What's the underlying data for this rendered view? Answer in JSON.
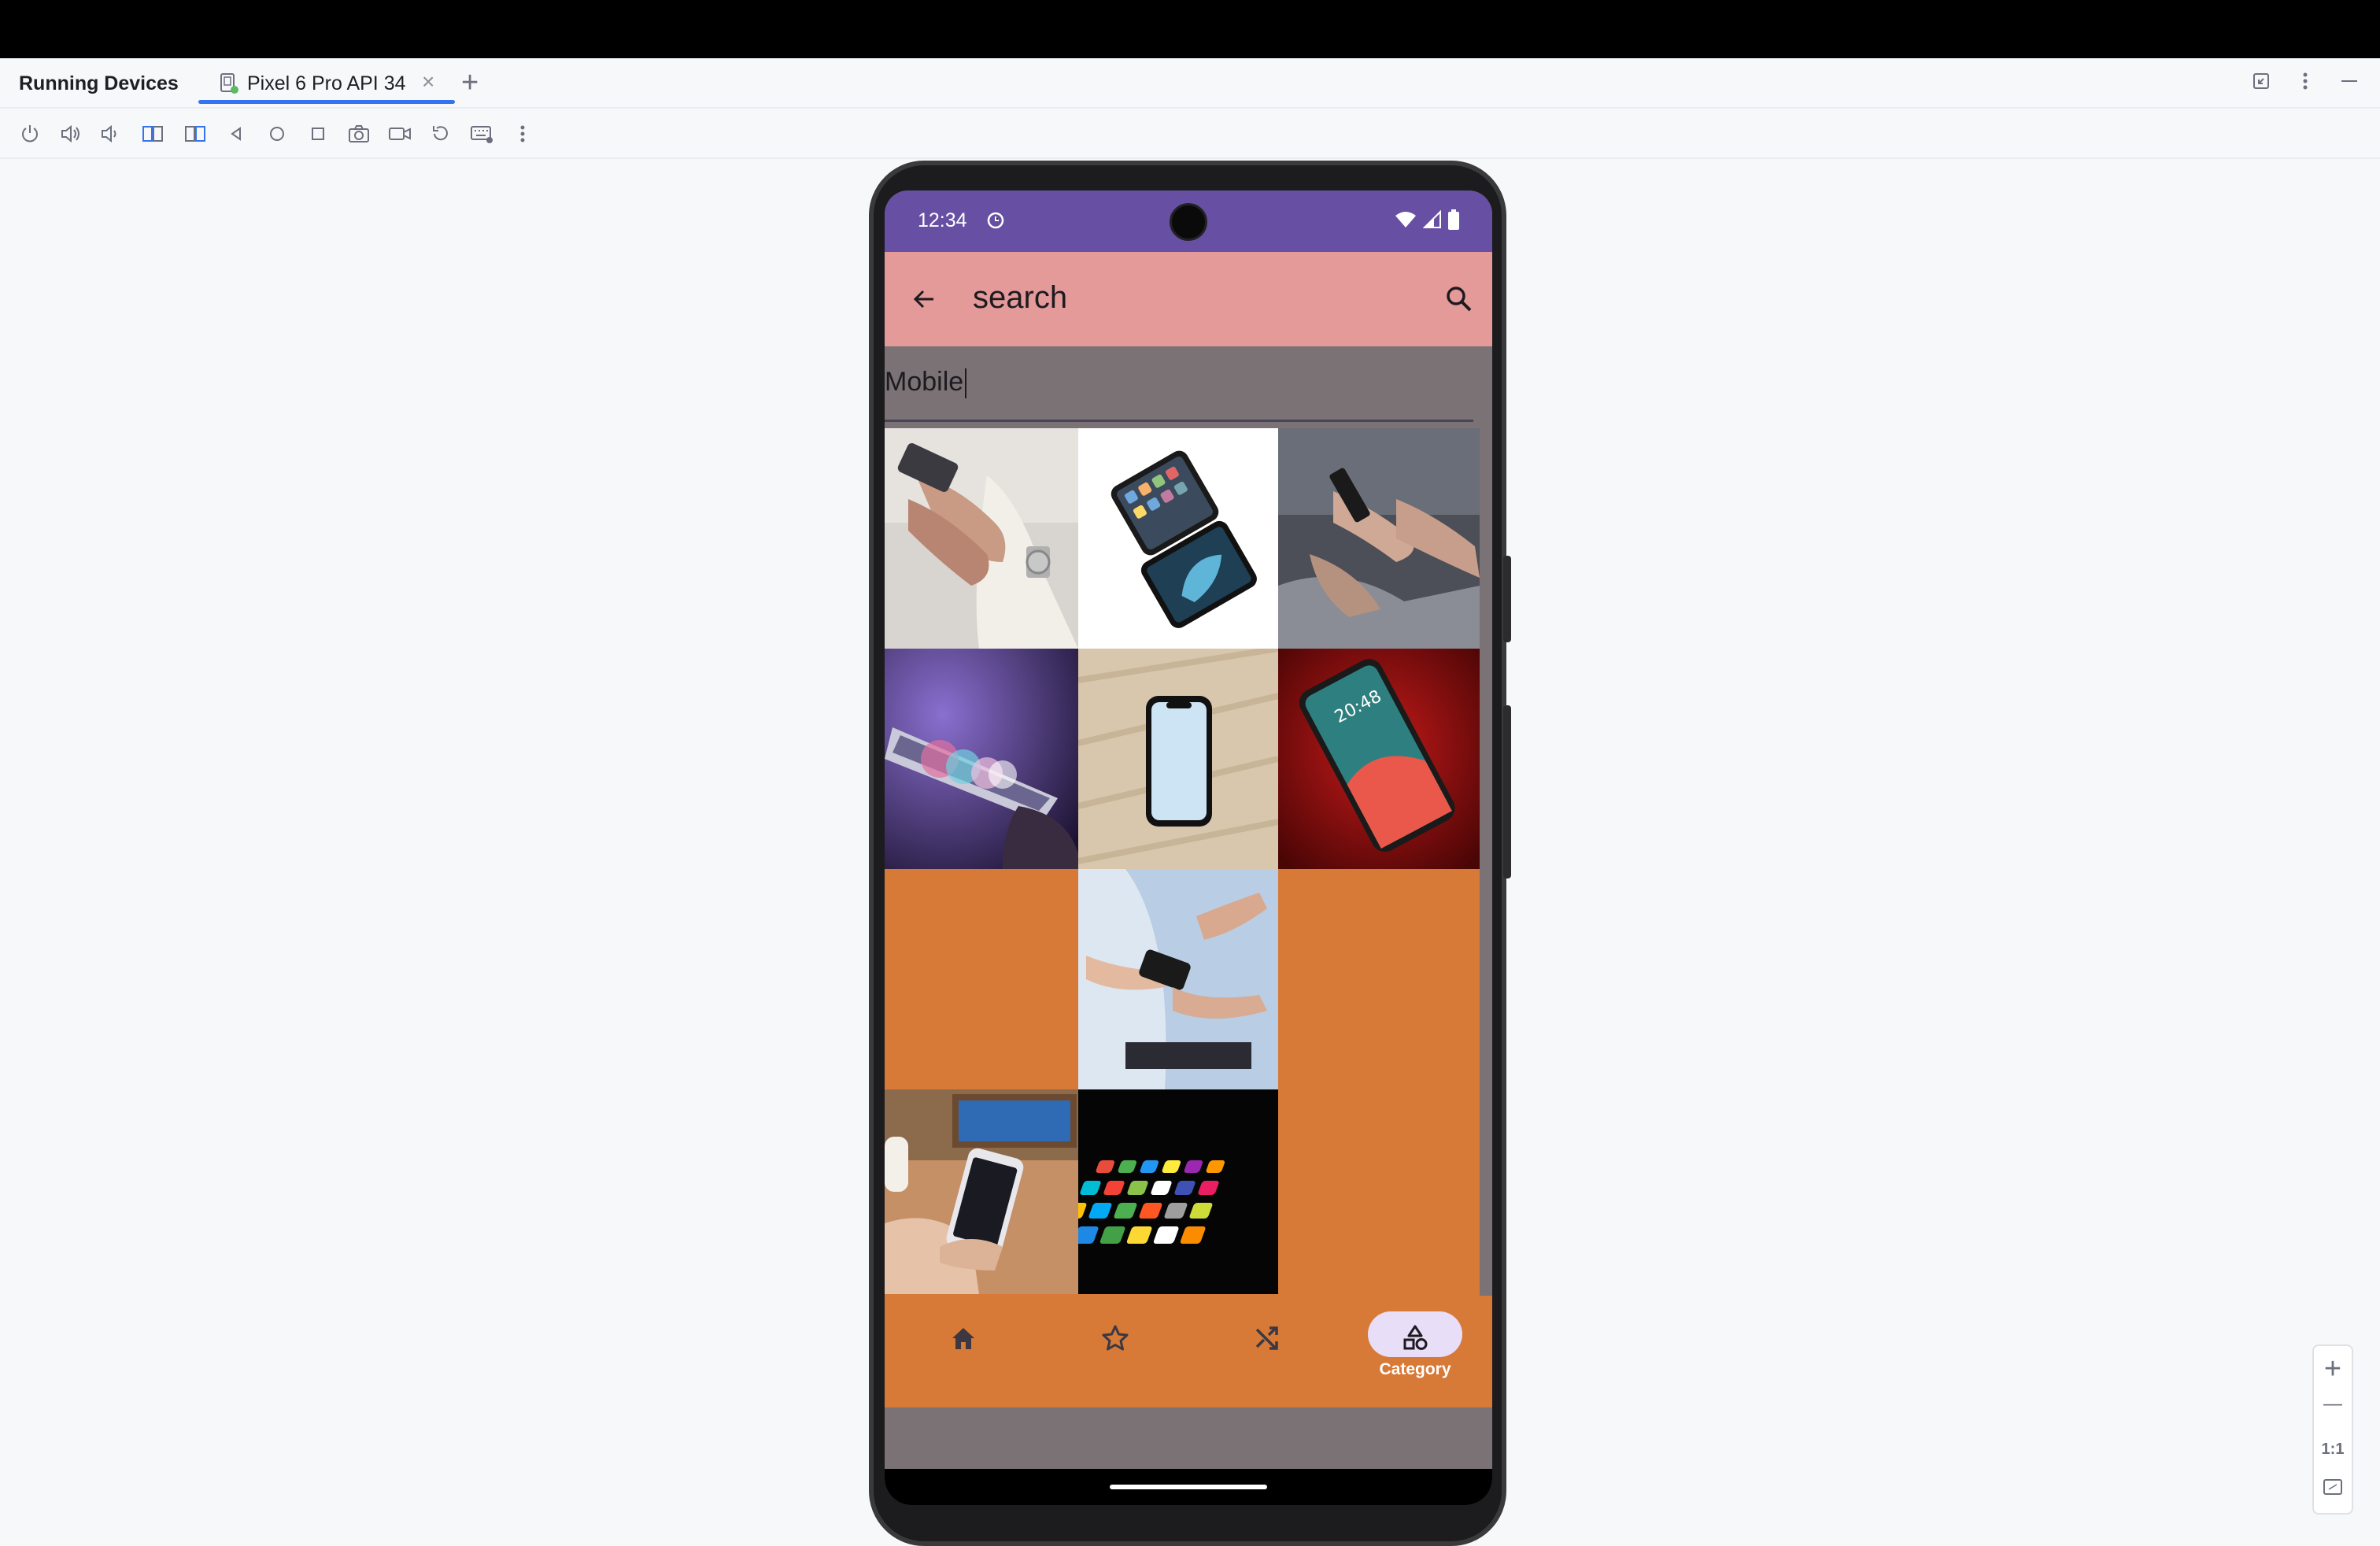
{
  "ide": {
    "panel_title": "Running Devices",
    "device_tab": "Pixel 6 Pro API 34",
    "tab_close": "×",
    "add_tab": "+",
    "window_buttons": [
      "restore-icon",
      "more-icon",
      "minimize-icon"
    ],
    "toolbar_icons": [
      "power-icon",
      "volume-up-icon",
      "volume-down-icon",
      "rotate-left-icon",
      "rotate-right-icon",
      "back-icon",
      "home-icon",
      "overview-icon",
      "screenshot-icon",
      "screen-record-icon",
      "reset-icon",
      "keyboard-icon",
      "more-icon"
    ],
    "zoom": {
      "plus": "+",
      "minus": "—",
      "actual": "1:1",
      "fit": "fit-screen-icon"
    }
  },
  "device": {
    "status_bar": {
      "time": "12:34",
      "icons": [
        "alarm-icon",
        "wifi-icon",
        "signal-icon",
        "battery-icon"
      ]
    },
    "app_bar": {
      "title": "search",
      "back_icon": "arrow-back-icon",
      "search_icon": "search-icon"
    },
    "search_field": {
      "value": "Mobile"
    },
    "grid": {
      "tiles": [
        {
          "name": "hands-holding-phone"
        },
        {
          "name": "two-iphones-white-bg"
        },
        {
          "name": "people-using-phones"
        },
        {
          "name": "purple-bokeh-phone"
        },
        {
          "name": "iphone-on-wood"
        },
        {
          "name": "iphone-on-red"
        },
        {
          "name": "empty-orange"
        },
        {
          "name": "businessmen-with-phone"
        },
        {
          "name": "empty-orange-tall"
        },
        {
          "name": "hand-holding-iphone-desk"
        },
        {
          "name": "phone-app-icons-dark"
        }
      ]
    },
    "bottom_nav": [
      {
        "icon": "home-icon",
        "label": ""
      },
      {
        "icon": "star-icon",
        "label": ""
      },
      {
        "icon": "shuffle-icon",
        "label": ""
      },
      {
        "icon": "category-icon",
        "label": "Category",
        "active": true
      }
    ]
  },
  "colors": {
    "status_bar": "#6750a4",
    "app_bar": "#e59a9a",
    "screen_bg": "#7a7274",
    "grid_bg": "#d77a37",
    "nav_pill": "#e8def8",
    "accent": "#3574f0"
  }
}
